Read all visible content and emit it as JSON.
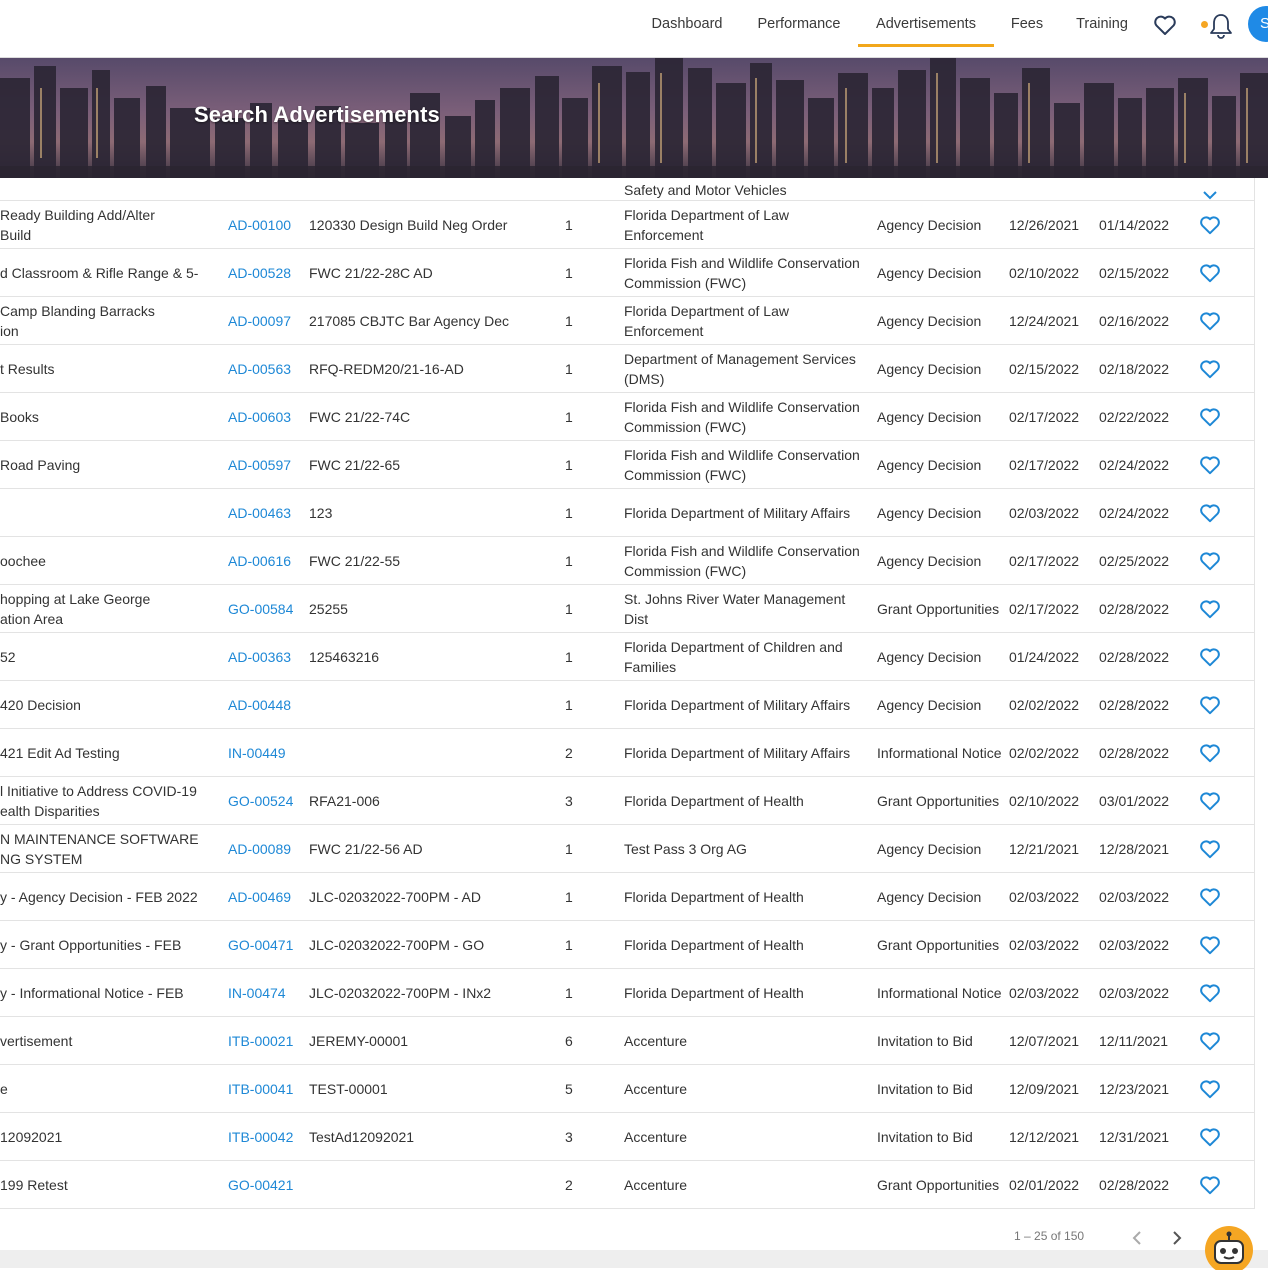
{
  "nav": {
    "items": [
      "Dashboard",
      "Performance",
      "Advertisements",
      "Fees",
      "Training"
    ],
    "active": "Advertisements",
    "avatar_initial": "S",
    "accent_color": "#f2a71b",
    "icons": [
      "heart-icon",
      "bell-icon"
    ]
  },
  "banner": {
    "title": "Search Advertisements"
  },
  "table": {
    "partial_top_row": {
      "agency": "Safety and Motor Vehicles"
    },
    "rows": [
      {
        "title": "Ready Building Add/Alter\nBuild",
        "number": "AD-00100",
        "solicitation": "120330 Design Build Neg Order",
        "qty": "1",
        "agency": "Florida Department of Law Enforcement",
        "type": "Agency Decision",
        "start": "12/26/2021",
        "end": "01/14/2022"
      },
      {
        "title": "d Classroom & Rifle Range & 5-",
        "number": "AD-00528",
        "solicitation": "FWC 21/22-28C AD",
        "qty": "1",
        "agency": "Florida Fish and Wildlife Conservation Commission (FWC)",
        "type": "Agency Decision",
        "start": "02/10/2022",
        "end": "02/15/2022"
      },
      {
        "title": "Camp Blanding Barracks\nion",
        "number": "AD-00097",
        "solicitation": "217085 CBJTC Bar Agency Dec",
        "qty": "1",
        "agency": "Florida Department of Law Enforcement",
        "type": "Agency Decision",
        "start": "12/24/2021",
        "end": "02/16/2022"
      },
      {
        "title": "t Results",
        "number": "AD-00563",
        "solicitation": "RFQ-REDM20/21-16-AD",
        "qty": "1",
        "agency": "Department of Management Services (DMS)",
        "type": "Agency Decision",
        "start": "02/15/2022",
        "end": "02/18/2022"
      },
      {
        "title": "Books",
        "number": "AD-00603",
        "solicitation": "FWC 21/22-74C",
        "qty": "1",
        "agency": "Florida Fish and Wildlife Conservation Commission (FWC)",
        "type": "Agency Decision",
        "start": "02/17/2022",
        "end": "02/22/2022"
      },
      {
        "title": "Road Paving",
        "number": "AD-00597",
        "solicitation": "FWC 21/22-65",
        "qty": "1",
        "agency": "Florida Fish and Wildlife Conservation Commission (FWC)",
        "type": "Agency Decision",
        "start": "02/17/2022",
        "end": "02/24/2022"
      },
      {
        "title": "",
        "number": "AD-00463",
        "solicitation": "123",
        "qty": "1",
        "agency": "Florida Department of Military Affairs",
        "type": "Agency Decision",
        "start": "02/03/2022",
        "end": "02/24/2022"
      },
      {
        "title": "oochee",
        "number": "AD-00616",
        "solicitation": "FWC 21/22-55",
        "qty": "1",
        "agency": "Florida Fish and Wildlife Conservation Commission (FWC)",
        "type": "Agency Decision",
        "start": "02/17/2022",
        "end": "02/25/2022"
      },
      {
        "title": "hopping at Lake George\nation Area",
        "number": "GO-00584",
        "solicitation": "25255",
        "qty": "1",
        "agency": "St. Johns River Water Management Dist",
        "type": "Grant Opportunities",
        "start": "02/17/2022",
        "end": "02/28/2022"
      },
      {
        "title": "52",
        "number": "AD-00363",
        "solicitation": "125463216",
        "qty": "1",
        "agency": "Florida Department of Children and Families",
        "type": "Agency Decision",
        "start": "01/24/2022",
        "end": "02/28/2022"
      },
      {
        "title": "420 Decision",
        "number": "AD-00448",
        "solicitation": "",
        "qty": "1",
        "agency": "Florida Department of Military Affairs",
        "type": "Agency Decision",
        "start": "02/02/2022",
        "end": "02/28/2022"
      },
      {
        "title": "421 Edit Ad Testing",
        "number": "IN-00449",
        "solicitation": "",
        "qty": "2",
        "agency": "Florida Department of Military Affairs",
        "type": "Informational Notice",
        "start": "02/02/2022",
        "end": "02/28/2022"
      },
      {
        "title": "l Initiative to Address COVID-19\nealth Disparities",
        "number": "GO-00524",
        "solicitation": "RFA21-006",
        "qty": "3",
        "agency": "Florida Department of Health",
        "type": "Grant Opportunities",
        "start": "02/10/2022",
        "end": "03/01/2022"
      },
      {
        "title": "N MAINTENANCE SOFTWARE\nNG SYSTEM",
        "number": "AD-00089",
        "solicitation": "FWC 21/22-56 AD",
        "qty": "1",
        "agency": "Test Pass 3 Org AG",
        "type": "Agency Decision",
        "start": "12/21/2021",
        "end": "12/28/2021"
      },
      {
        "title": "y - Agency Decision - FEB 2022",
        "number": "AD-00469",
        "solicitation": "JLC-02032022-700PM - AD",
        "qty": "1",
        "agency": "Florida Department of Health",
        "type": "Agency Decision",
        "start": "02/03/2022",
        "end": "02/03/2022"
      },
      {
        "title": "y - Grant Opportunities - FEB",
        "number": "GO-00471",
        "solicitation": "JLC-02032022-700PM - GO",
        "qty": "1",
        "agency": "Florida Department of Health",
        "type": "Grant Opportunities",
        "start": "02/03/2022",
        "end": "02/03/2022"
      },
      {
        "title": "y - Informational Notice - FEB",
        "number": "IN-00474",
        "solicitation": "JLC-02032022-700PM - INx2",
        "qty": "1",
        "agency": "Florida Department of Health",
        "type": "Informational Notice",
        "start": "02/03/2022",
        "end": "02/03/2022"
      },
      {
        "title": "vertisement",
        "number": "ITB-00021",
        "solicitation": "JEREMY-00001",
        "qty": "6",
        "agency": "Accenture",
        "type": "Invitation to Bid",
        "start": "12/07/2021",
        "end": "12/11/2021"
      },
      {
        "title": "e",
        "number": "ITB-00041",
        "solicitation": "TEST-00001",
        "qty": "5",
        "agency": "Accenture",
        "type": "Invitation to Bid",
        "start": "12/09/2021",
        "end": "12/23/2021"
      },
      {
        "title": "12092021",
        "number": "ITB-00042",
        "solicitation": "TestAd12092021",
        "qty": "3",
        "agency": "Accenture",
        "type": "Invitation to Bid",
        "start": "12/12/2021",
        "end": "12/31/2021"
      },
      {
        "title": "199 Retest",
        "number": "GO-00421",
        "solicitation": "",
        "qty": "2",
        "agency": "Accenture",
        "type": "Grant Opportunities",
        "start": "02/01/2022",
        "end": "02/28/2022"
      }
    ]
  },
  "pagination": {
    "range_text": "1 – 25 of 150"
  },
  "colors": {
    "link": "#1e88d6",
    "heart": "#1e88d6",
    "avatar": "#1f8ae6"
  }
}
